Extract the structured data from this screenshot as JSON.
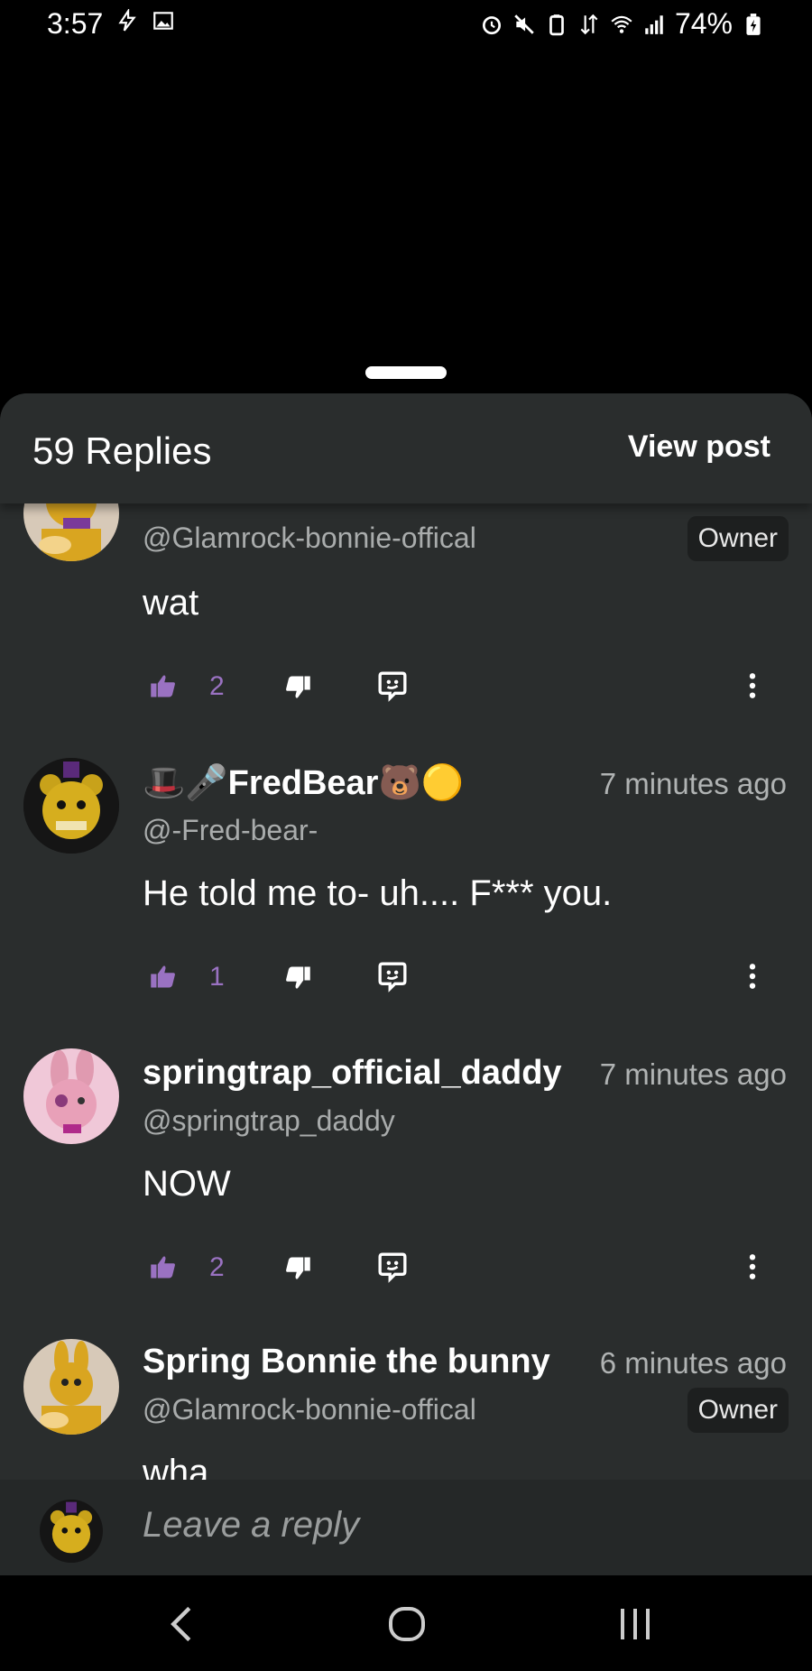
{
  "status_bar": {
    "time": "3:57",
    "battery": "74%"
  },
  "sheet": {
    "title": "59 Replies",
    "view_post_label": "View post"
  },
  "comments": [
    {
      "name": "",
      "handle": "@Glamrock-bonnie-offical",
      "time": "",
      "badge": "Owner",
      "text": "wat",
      "likes": "2"
    },
    {
      "name": "🎩🎤FredBear🐻🟡",
      "handle": "@-Fred-bear-",
      "time": "7 minutes ago",
      "badge": "",
      "text": "He told me to- uh.... F*** you.",
      "likes": "1"
    },
    {
      "name": "springtrap_official_daddy",
      "handle": "@springtrap_daddy",
      "time": "7 minutes ago",
      "badge": "",
      "text": "NOW",
      "likes": "2"
    },
    {
      "name": "Spring Bonnie the bunny",
      "handle": "@Glamrock-bonnie-offical",
      "time": "6 minutes ago",
      "badge": "Owner",
      "text": "wha",
      "likes": ""
    }
  ],
  "reply_bar": {
    "placeholder": "Leave a reply"
  },
  "colors": {
    "sheet_bg": "#2a2d2d",
    "accent_purple": "#9a72c2",
    "muted_text": "#a9acac"
  }
}
